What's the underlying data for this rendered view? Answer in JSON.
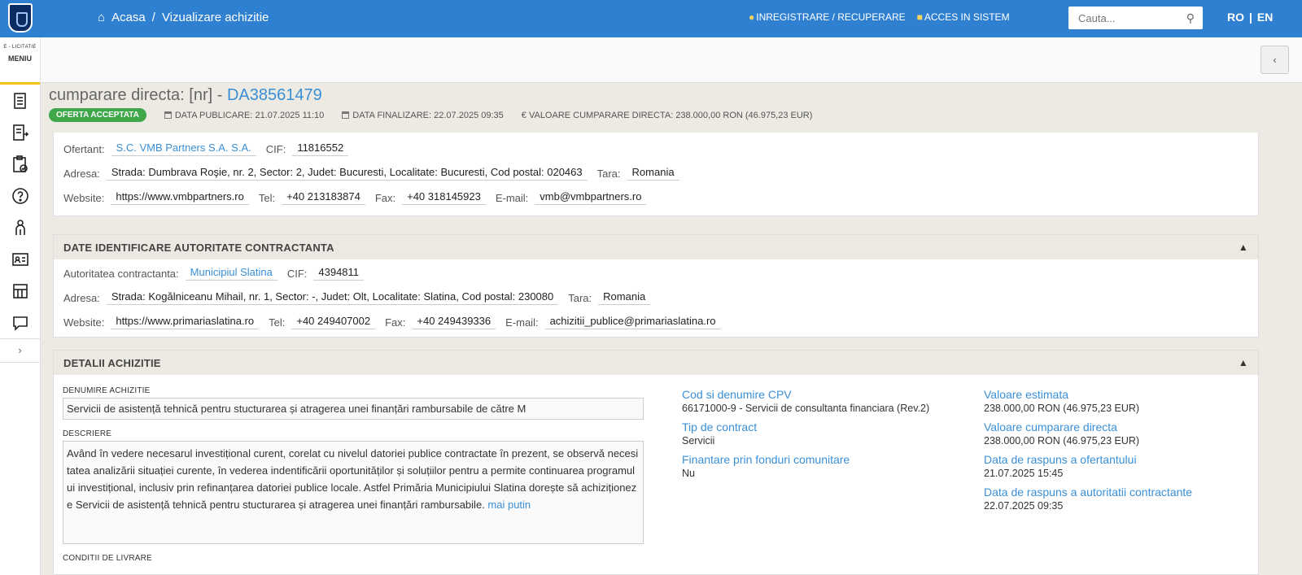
{
  "topbar": {
    "breadcrumb": [
      "Acasa",
      "Vizualizare achizitie"
    ],
    "links": [
      "INREGISTRARE / RECUPERARE",
      "ACCES IN SISTEM"
    ],
    "search_placeholder": "Cauta...",
    "lang": [
      "RO",
      "|",
      "EN"
    ]
  },
  "sidebar": {
    "brand_small": "E - LICITATIE",
    "menu_label": "MENIU",
    "icons": [
      "document-icon",
      "list-export-icon",
      "clipboard-check-icon",
      "help-icon",
      "person-icon",
      "id-card-icon",
      "store-icon",
      "chat-icon"
    ],
    "expand": "›"
  },
  "header": {
    "title_prefix": "cumparare directa: [nr] - ",
    "code": "DA38561479",
    "status_badge": "OFERTA ACCEPTATA",
    "data_publicare": "DATA PUBLICARE: 21.07.2025 11:10",
    "data_finalizare": "DATA FINALIZARE: 22.07.2025 09:35",
    "valoare": "€ VALOARE CUMPARARE DIRECTA: 238.000,00  RON (46.975,23  EUR)"
  },
  "ofertant": {
    "label_ofertant": "Ofertant:",
    "name": "S.C. VMB Partners S.A. S.A.",
    "label_cif": "CIF:",
    "cif": "11816552",
    "label_adresa": "Adresa:",
    "adresa": "Strada: Dumbrava Roşie, nr. 2, Sector: 2, Judet: Bucuresti, Localitate: Bucuresti, Cod postal: 020463",
    "label_tara": "Tara:",
    "tara": "Romania",
    "label_website": "Website:",
    "website": "https://www.vmbpartners.ro",
    "label_tel": "Tel:",
    "tel": "+40 213183874",
    "label_fax": "Fax:",
    "fax": "+40 318145923",
    "label_email": "E-mail:",
    "email": "vmb@vmbpartners.ro"
  },
  "autoritate": {
    "section_title": "DATE IDENTIFICARE AUTORITATE CONTRACTANTA",
    "label_autoritate": "Autoritatea contractanta:",
    "name": "Municipiul Slatina",
    "label_cif": "CIF:",
    "cif": "4394811",
    "label_adresa": "Adresa:",
    "adresa": "Strada: Kogălniceanu Mihail, nr. 1, Sector: -, Judet: Olt, Localitate: Slatina, Cod postal: 230080",
    "label_tara": "Tara:",
    "tara": "Romania",
    "label_website": "Website:",
    "website": "https://www.primariaslatina.ro",
    "label_tel": "Tel:",
    "tel": "+40 249407002",
    "label_fax": "Fax:",
    "fax": "+40 249439336",
    "label_email": "E-mail:",
    "email": "achizitii_publice@primariaslatina.ro"
  },
  "detalii": {
    "section_title": "DETALII ACHIZITIE",
    "denumire_label": "DENUMIRE ACHIZITIE",
    "denumire": "Servicii de asistență tehnică pentru stucturarea și atragerea unei finanțări rambursabile de către M",
    "descriere_label": "DESCRIERE",
    "descriere": "Având în vedere necesarul investițional curent, corelat cu nivelul datoriei publice contractate în prezent, se observă necesitatea analizării situației curente, în vederea indentificării oportunităților și soluțiilor pentru a permite continuarea programului investițional, inclusiv prin refinanțarea datoriei publice locale. Astfel Primăria Municipiului Slatina dorește să achiziționeze Servicii de asistență tehnică pentru stucturarea și atragerea unei finanțări rambursabile.",
    "mai_putin": "mai putin",
    "next_label": "CONDITII DE LIVRARE",
    "cpv_title": "Cod si denumire CPV",
    "cpv_value": "66171000-9 - Servicii de consultanta financiara (Rev.2)",
    "tip_title": "Tip de contract",
    "tip_value": "Servicii",
    "finantare_title": "Finantare prin fonduri comunitare",
    "finantare_value": "Nu",
    "val_est_title": "Valoare estimata",
    "val_est_value": "238.000,00  RON (46.975,23  EUR)",
    "val_cd_title": "Valoare cumparare directa",
    "val_cd_value": "238.000,00  RON (46.975,23  EUR)",
    "raspuns_of_title": "Data de raspuns a ofertantului",
    "raspuns_of_value": "21.07.2025 15:45",
    "raspuns_aut_title": "Data de raspuns a autoritatii contractante",
    "raspuns_aut_value": "22.07.2025 09:35"
  },
  "colors": {
    "topbar": "#2f80d1",
    "accent": "#3a8fd6",
    "badge": "#3fa64a",
    "menu_underline": "#f1c40f"
  }
}
